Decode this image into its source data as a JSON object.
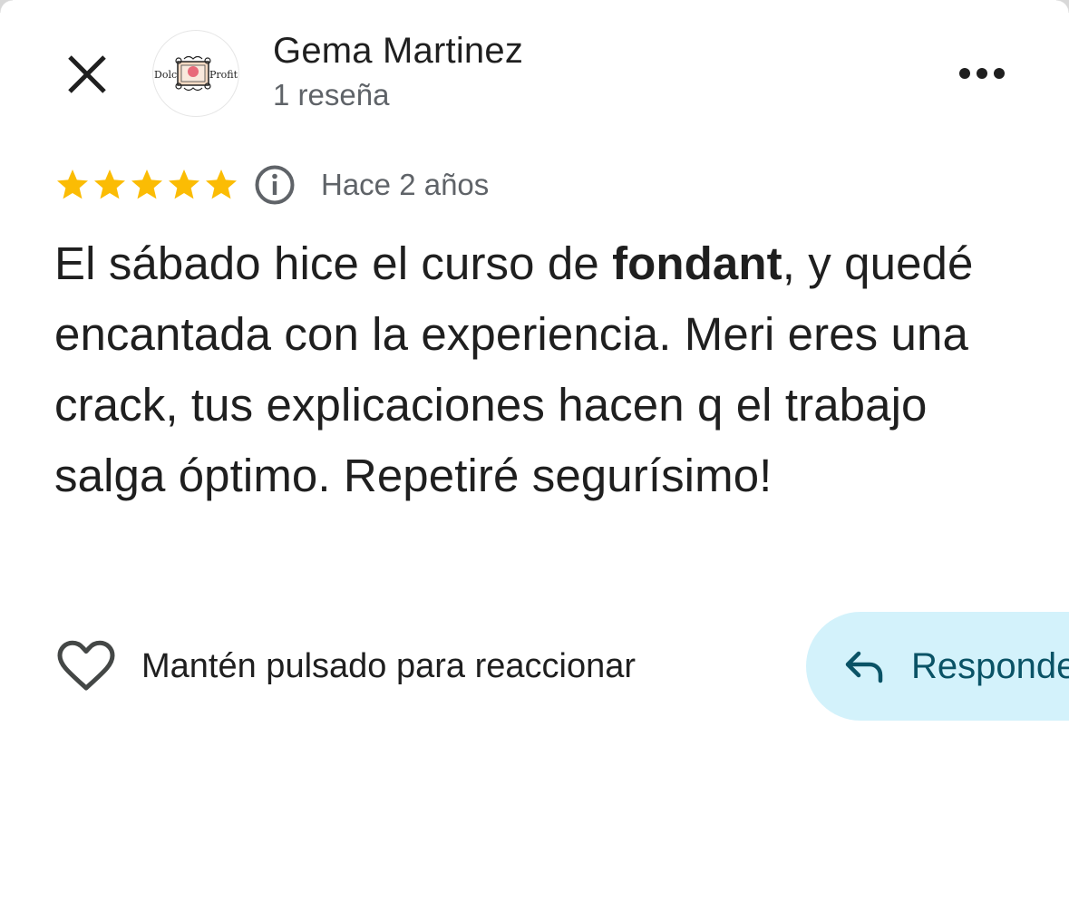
{
  "header": {
    "close_icon": "close-icon",
    "avatar_logo_text_left": "Dolc",
    "avatar_logo_text_right": "Profit",
    "author_name": "Gema Martinez",
    "review_count": "1 reseña",
    "more_icon": "more-horizontal-icon"
  },
  "review": {
    "rating": 5,
    "rating_max": 5,
    "star_color": "#fbbc04",
    "info_icon": "info-icon",
    "date": "Hace 2 años",
    "text_before_bold": "El sábado hice el curso de ",
    "text_bold": "fondant",
    "text_after_bold": ", y quedé encantada con la experiencia. Meri eres una crack, tus explicaciones hacen q el trabajo salga óptimo. Repetiré segurísimo!"
  },
  "actions": {
    "heart_icon": "heart-icon",
    "react_label": "Mantén pulsado para reaccionar",
    "reply_icon": "reply-icon",
    "reply_label": "Responder",
    "reply_bg_color": "#d3f2fb",
    "reply_text_color": "#0a5366"
  }
}
